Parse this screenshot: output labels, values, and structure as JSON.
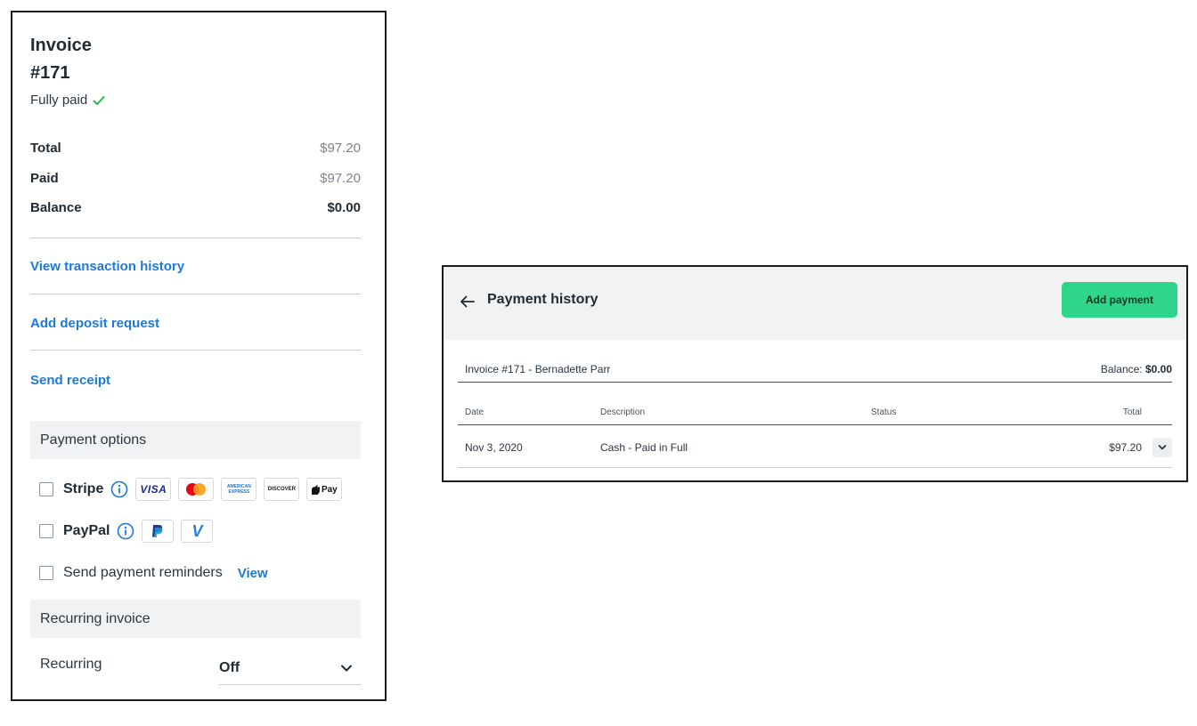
{
  "invoice": {
    "title": "Invoice",
    "number": "#171",
    "status": "Fully paid",
    "summary": [
      {
        "label": "Total",
        "value": "$97.20"
      },
      {
        "label": "Paid",
        "value": "$97.20"
      },
      {
        "label": "Balance",
        "value": "$0.00"
      }
    ],
    "links": {
      "transaction_history": "View transaction history",
      "deposit_request": "Add deposit request",
      "send_receipt": "Send receipt"
    },
    "payment_options": {
      "heading": "Payment options",
      "stripe_label": "Stripe",
      "paypal_label": "PayPal",
      "stripe_cards": [
        "VISA",
        "mastercard",
        "AMERICAN EXPRESS",
        "DISCOVER",
        "Pay"
      ],
      "reminders_label": "Send payment reminders",
      "reminders_view": "View"
    },
    "recurring": {
      "heading": "Recurring invoice",
      "label": "Recurring",
      "value": "Off"
    }
  },
  "history": {
    "title": "Payment history",
    "add_payment": "Add payment",
    "invoice_ref": "Invoice #171 - Bernadette Parr",
    "balance_label": "Balance:",
    "balance_value": "$0.00",
    "columns": {
      "date": "Date",
      "description": "Description",
      "status": "Status",
      "total": "Total"
    },
    "rows": [
      {
        "date": "Nov 3, 2020",
        "description": "Cash - Paid in Full",
        "status": "",
        "total": "$97.20"
      }
    ]
  },
  "colors": {
    "link": "#1e7ad6",
    "success": "#2fb344",
    "add_payment_bg": "#2ed58a"
  }
}
